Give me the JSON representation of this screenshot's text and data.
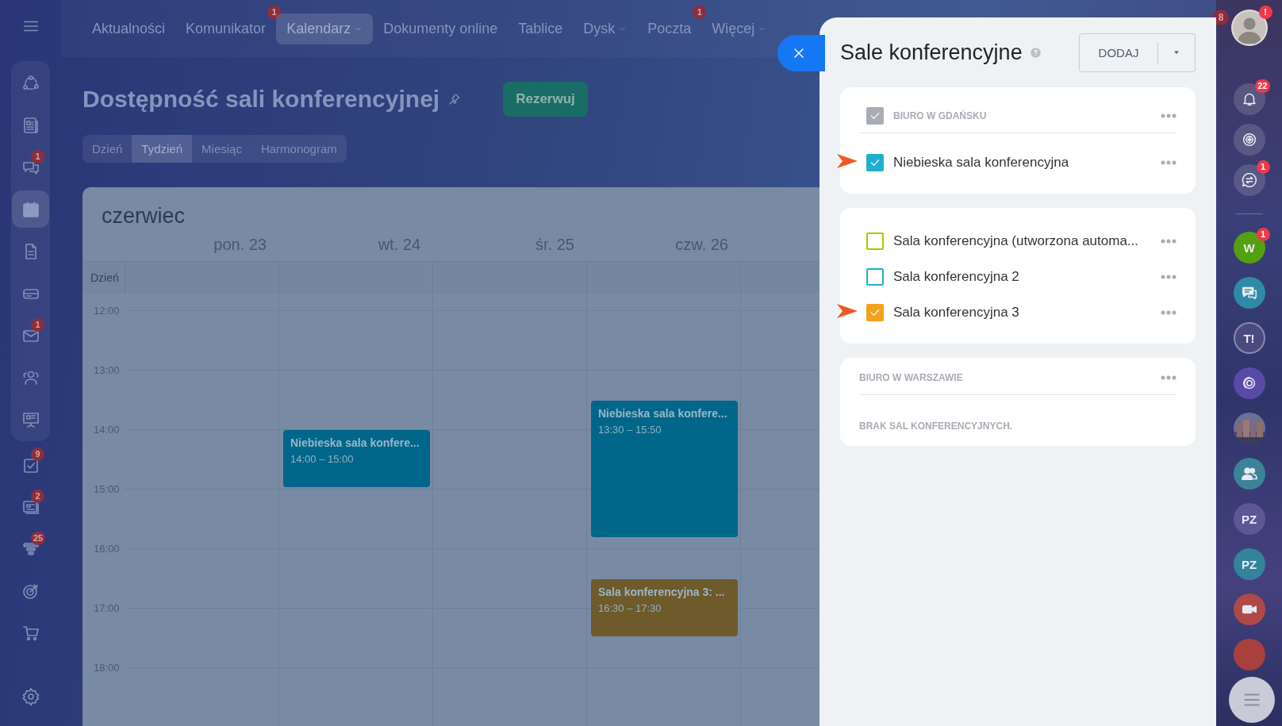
{
  "left_sidebar": {
    "pinned_items": [
      {
        "selected": false
      },
      {
        "selected": false
      },
      {
        "selected": false,
        "badge": "1"
      },
      {
        "selected": true
      },
      {
        "selected": false
      },
      {
        "selected": false
      },
      {
        "selected": false,
        "badge": "1"
      },
      {
        "selected": false
      },
      {
        "selected": false
      }
    ],
    "items": [
      {
        "selected": false,
        "badge": "9"
      },
      {
        "selected": false,
        "badge": "2"
      },
      {
        "selected": false,
        "badge": "25"
      },
      {
        "selected": false
      },
      {
        "selected": false
      }
    ]
  },
  "top_nav": {
    "items": [
      {
        "label": "Aktualności",
        "selected": false,
        "dropdown": false
      },
      {
        "label": "Komunikator",
        "selected": false,
        "dropdown": false,
        "badge": "1"
      },
      {
        "label": "Kalendarz",
        "selected": true,
        "dropdown": true
      },
      {
        "label": "Dokumenty online",
        "selected": false,
        "dropdown": false
      },
      {
        "label": "Tablice",
        "selected": false,
        "dropdown": false
      },
      {
        "label": "Dysk",
        "selected": false,
        "dropdown": true
      },
      {
        "label": "Poczta",
        "selected": false,
        "dropdown": false,
        "badge": "1"
      },
      {
        "label": "Więcej",
        "selected": false,
        "dropdown": true
      }
    ]
  },
  "page": {
    "title": "Dostępność sali konferencyjnej",
    "button": "Rezerwuj",
    "view_tabs": [
      {
        "label": "Dzień",
        "selected": false
      },
      {
        "label": "Tydzień",
        "selected": true
      },
      {
        "label": "Miesiąc",
        "selected": false
      },
      {
        "label": "Harmonogram",
        "selected": false
      }
    ]
  },
  "calendar": {
    "month": "czerwiec",
    "all_day_label": "Dzień",
    "times": [
      "12:00",
      "13:00",
      "14:00",
      "15:00",
      "16:00",
      "17:00",
      "18:00"
    ],
    "days": [
      {
        "label": "pon. 23"
      },
      {
        "label": "wt. 24",
        "events": [
          {
            "title": "Niebieska sala konfere...",
            "time": "14:00 – 15:00",
            "color": "#00668a"
          }
        ]
      },
      {
        "label": "śr. 25"
      },
      {
        "label": "czw. 26",
        "events": [
          {
            "title": "Niebieska sala konfere...",
            "time": "13:30 – 15:50",
            "color": "#00668a"
          },
          {
            "title": "Sala konferencyjna 3: ...",
            "time": "16:30 – 17:30",
            "color": "#6e5a2b"
          }
        ]
      }
    ]
  },
  "panel": {
    "title": "Sale konferencyjne",
    "add_button": "DODAJ",
    "sections": [
      {
        "header": "BIURO W GDAŃSKU",
        "header_checked": true,
        "rooms": [
          {
            "name": "Niebieska sala konferencyjna",
            "checked": true,
            "color": "#1eb0cd",
            "pointer": true
          }
        ]
      },
      {
        "rooms": [
          {
            "name": "Sala konferencyjna (utworzona automa...",
            "checked": false,
            "color": "#9dcf00",
            "pointer": false
          },
          {
            "name": "Sala konferencyjna 2",
            "checked": false,
            "color": "#1eb0cd",
            "pointer": false
          },
          {
            "name": "Sala konferencyjna 3",
            "checked": true,
            "color": "#f2a21c",
            "pointer": true
          }
        ]
      },
      {
        "header": "BIURO W WARSZAWIE",
        "empty_text": "BRAK SAL KONFERENCYJNYCH."
      }
    ]
  },
  "right_bar": {
    "top_badge": "8",
    "items": [
      {
        "kind": "avatar",
        "badge": "!"
      },
      {
        "kind": "icon",
        "badge": "22"
      },
      {
        "kind": "icon"
      },
      {
        "kind": "icon",
        "badge": "1"
      },
      {
        "kind": "divider"
      },
      {
        "kind": "letters",
        "text": "W",
        "color": "#55a010",
        "badge": "1"
      },
      {
        "kind": "icon",
        "color": "#2f8aa6"
      },
      {
        "kind": "letters",
        "text": "T!",
        "color": "#4b4a80"
      },
      {
        "kind": "icon",
        "color": "#5a4aa8"
      },
      {
        "kind": "picture"
      },
      {
        "kind": "icon",
        "color": "#3d8397"
      },
      {
        "kind": "letters",
        "text": "PZ",
        "color": "#5d5796"
      },
      {
        "kind": "letters",
        "text": "PZ",
        "color": "#33849a"
      },
      {
        "kind": "icon",
        "color": "#b04848"
      },
      {
        "kind": "circle",
        "color": "#a8403e"
      }
    ]
  }
}
